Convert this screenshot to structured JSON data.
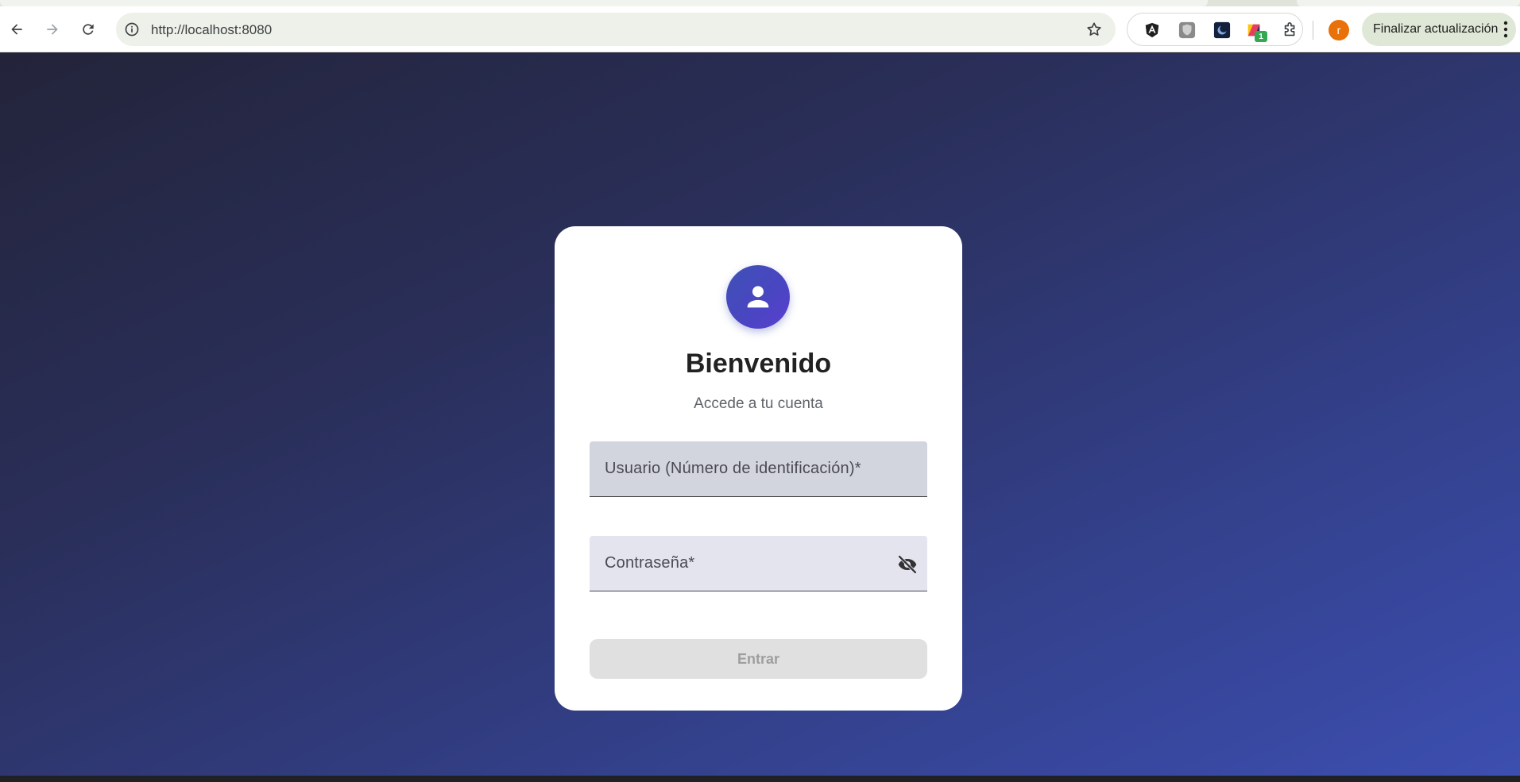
{
  "browser": {
    "url": "http://localhost:8080",
    "profile_initial": "r",
    "update_label": "Finalizar actualización",
    "extensions": [
      "angular-devtools-icon",
      "shield-extension-icon",
      "dark-extension-icon",
      "color-extension-icon"
    ],
    "extension_badge": "1"
  },
  "login": {
    "title": "Bienvenido",
    "subtitle": "Accede a tu cuenta",
    "user_placeholder": "Usuario (Número de identificación)*",
    "password_placeholder": "Contraseña*",
    "submit_label": "Entrar"
  },
  "colors": {
    "accent": "#3f51b5",
    "update_button_bg": "#dfe8d6",
    "profile": "#e8710a"
  }
}
